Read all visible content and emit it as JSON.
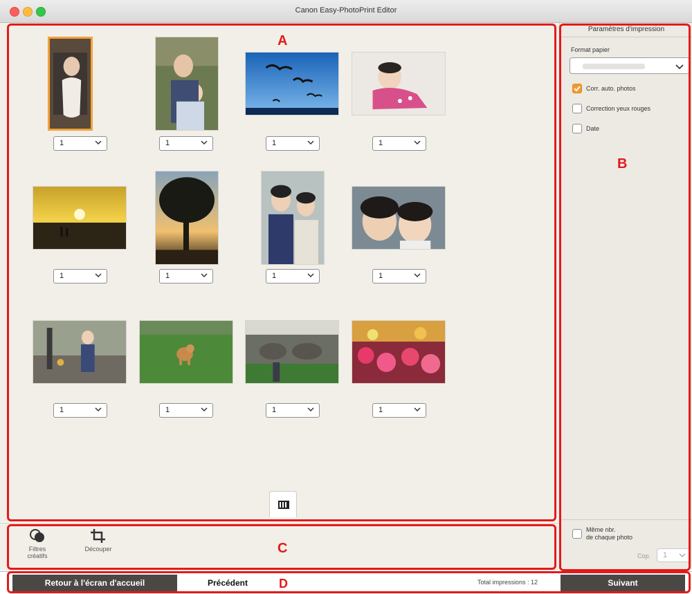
{
  "window": {
    "title": "Canon Easy-PhotoPrint Editor"
  },
  "markers": {
    "a": "A",
    "b": "B",
    "c": "C",
    "d": "D"
  },
  "photos": [
    {
      "name": "baby-blanket",
      "qty": "1",
      "selected": true
    },
    {
      "name": "sisters-hug",
      "qty": "1"
    },
    {
      "name": "birds-sky",
      "qty": "1"
    },
    {
      "name": "baby-pink",
      "qty": "1"
    },
    {
      "name": "sunset-beach",
      "qty": "1"
    },
    {
      "name": "tree-sunset",
      "qty": "1"
    },
    {
      "name": "girls-portrait",
      "qty": "1"
    },
    {
      "name": "girls-closeup",
      "qty": "1"
    },
    {
      "name": "child-walking",
      "qty": "1"
    },
    {
      "name": "dog-grass",
      "qty": "1"
    },
    {
      "name": "elephants-zoo",
      "qty": "1"
    },
    {
      "name": "flower-market",
      "qty": "1"
    }
  ],
  "toolbar": {
    "filters_label_1": "Filtres",
    "filters_label_2": "créatifs",
    "crop_label": "Découper"
  },
  "settings": {
    "title": "Paramètres d'impression",
    "paper_label": "Format papier",
    "auto_correct": "Corr. auto. photos",
    "red_eye": "Correction yeux rouges",
    "date": "Date",
    "same_count_1": "Même nbr.",
    "same_count_2": "de chaque photo",
    "copies_label": "Cop.",
    "copies_value": "1"
  },
  "footer": {
    "home_button": "Retour à l'écran d'accueil",
    "prev_button": "Précédent",
    "total": "Total impressions : 12",
    "next_button": "Suivant"
  },
  "colors": {
    "accent_red": "#e31a1a",
    "checkbox_orange": "#f29a2e",
    "dark_button": "#4a4844"
  }
}
